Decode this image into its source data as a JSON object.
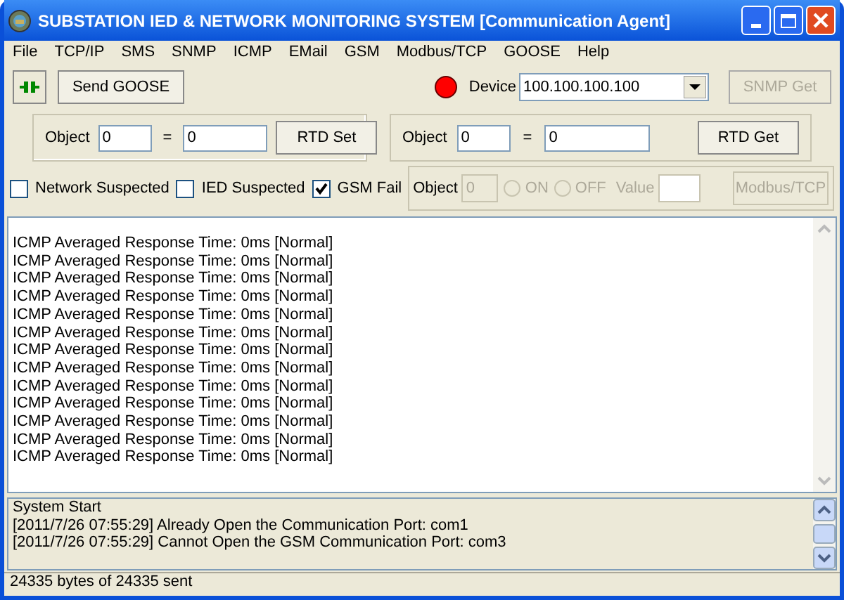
{
  "window": {
    "title": "SUBSTATION IED & NETWORK MONITORING SYSTEM [Communication Agent]"
  },
  "menu": [
    "File",
    "TCP/IP",
    "SMS",
    "SNMP",
    "ICMP",
    "EMail",
    "GSM",
    "Modbus/TCP",
    "GOOSE",
    "Help"
  ],
  "toolbar": {
    "send_button": "Send GOOSE",
    "device_online": false,
    "device_label": "Device",
    "device_value": "100.100.100.100",
    "snmp_button": {
      "label": "SNMP Get",
      "disabled": true
    }
  },
  "rtd_set": {
    "object_label": "Object",
    "object_value": "0",
    "equals": "=",
    "value": "0",
    "button": "RTD Set"
  },
  "rtd_get": {
    "object_label": "Object",
    "object_value": "0",
    "equals": "=",
    "value": "0",
    "button": "RTD Get"
  },
  "checkboxes": [
    {
      "label": "Network Suspected",
      "checked": false
    },
    {
      "label": "IED Suspected",
      "checked": false
    },
    {
      "label": "GSM Fail",
      "checked": true
    }
  ],
  "modbus": {
    "disabled": true,
    "object_label": "Object",
    "object_value": "0",
    "radios": [
      {
        "label": "ON",
        "selected": false
      },
      {
        "label": "OFF",
        "selected": false
      }
    ],
    "value_label": "Value",
    "button": "Modbus/TCP"
  },
  "response_log": [
    "ICMP Averaged Response Time: 0ms [Normal]",
    "ICMP Averaged Response Time: 0ms [Normal]",
    "ICMP Averaged Response Time: 0ms [Normal]",
    "ICMP Averaged Response Time: 0ms [Normal]",
    "ICMP Averaged Response Time: 0ms [Normal]",
    "ICMP Averaged Response Time: 0ms [Normal]",
    "ICMP Averaged Response Time: 0ms [Normal]",
    "ICMP Averaged Response Time: 0ms [Normal]",
    "ICMP Averaged Response Time: 0ms [Normal]",
    "ICMP Averaged Response Time: 0ms [Normal]",
    "ICMP Averaged Response Time: 0ms [Normal]",
    "ICMP Averaged Response Time: 0ms [Normal]",
    "ICMP Averaged Response Time: 0ms [Normal]"
  ],
  "system_log": [
    "System Start",
    "[2011/7/26 07:55:29] Already Open the Communication Port: com1",
    "[2011/7/26 07:55:29] Cannot Open the GSM Communication Port: com3"
  ],
  "status_bar": "24335 bytes of 24335 sent"
}
